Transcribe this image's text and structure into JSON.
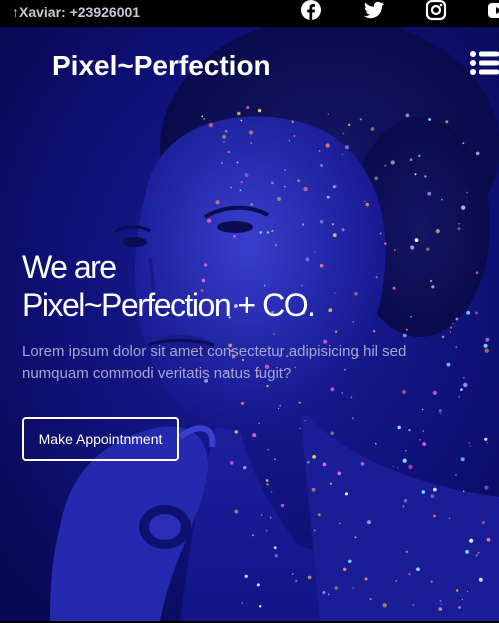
{
  "topbar": {
    "contact_text": "↑Xaviar: +23926001",
    "social_icons": [
      "facebook-icon",
      "twitter-icon",
      "instagram-icon",
      "youtube-icon"
    ]
  },
  "header": {
    "brand": "Pixel~Perfection",
    "menu_icon": "list-icon"
  },
  "hero": {
    "headline_line1": "We are",
    "headline_line2": "Pixel~Perfection + CO.",
    "lead": "Lorem ipsum dolor sit amet consectetur adipisicing hil sed numquam commodi veritatis natus fugit?",
    "cta_label": "Make Appointnment"
  },
  "colors": {
    "overlay": "#0d0e6b",
    "topbar_bg": "#000000",
    "text": "#ffffff",
    "muted_text": "#a7a6d0"
  }
}
